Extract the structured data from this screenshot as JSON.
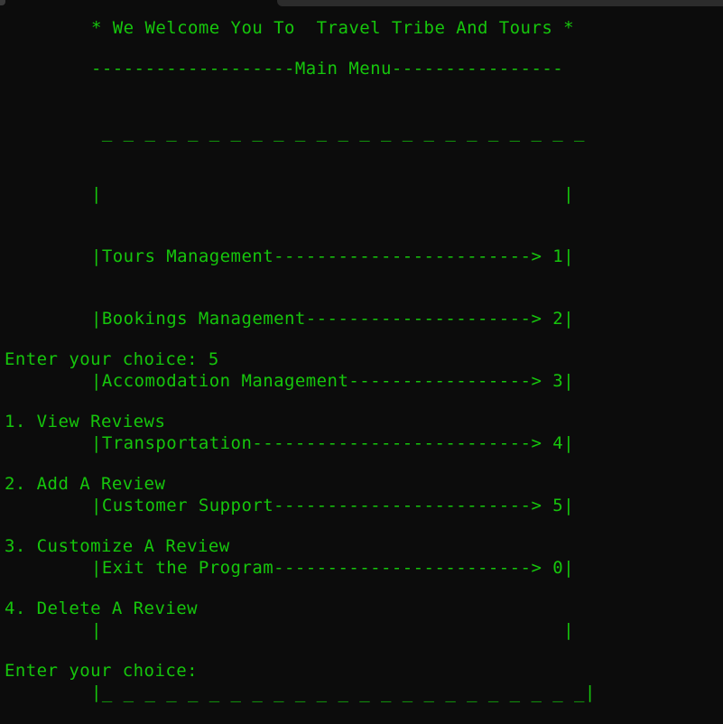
{
  "welcome": "* We Welcome You To  Travel Tribe And Tours *",
  "menu_header": "-------------------Main Menu----------------",
  "menu_box_top": " _ _ _ _ _ _ _ _ _ _ _ _ _ _ _ _ _ _ _ _ _ _ _",
  "menu_box_blank": "|                                           |",
  "menu_items": [
    "|Tours Management------------------------> 1|",
    "|Bookings Management---------------------> 2|",
    "|Accomodation Management-----------------> 3|",
    "|Transportation--------------------------> 4|",
    "|Customer Support------------------------> 5|",
    "|Exit the Program------------------------> 0|"
  ],
  "menu_box_bottom": "|_ _ _ _ _ _ _ _ _ _ _ _ _ _ _ _ _ _ _ _ _ _ _|",
  "session": {
    "prompt_1": "Enter your choice: 5",
    "options": [
      "1. View Reviews",
      "2. Add A Review",
      "3. Customize A Review",
      "4. Delete A Review"
    ],
    "prompt_2": "Enter your choice: "
  },
  "colors": {
    "background": "#0c0c0c",
    "text": "#16c60c"
  }
}
